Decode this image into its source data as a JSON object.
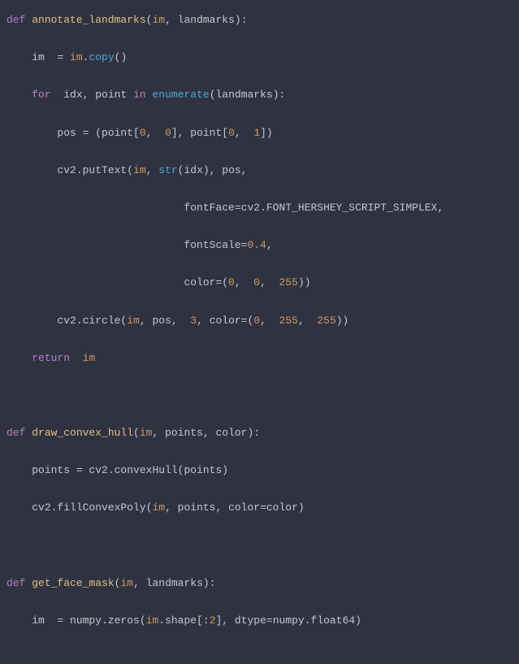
{
  "code": {
    "lines": [
      {
        "indent": 0,
        "tokens": [
          {
            "t": "def ",
            "c": "kw"
          },
          {
            "t": "annotate_landmarks",
            "c": "fn"
          },
          {
            "t": "(",
            "c": "punct"
          },
          {
            "t": "im",
            "c": "param"
          },
          {
            "t": ", landmarks):",
            "c": "punct"
          }
        ]
      },
      {
        "indent": 4,
        "tokens": [
          {
            "t": "im  = ",
            "c": "punct"
          },
          {
            "t": "im",
            "c": "param"
          },
          {
            "t": ".",
            "c": "punct"
          },
          {
            "t": "copy",
            "c": "call"
          },
          {
            "t": "()",
            "c": "punct"
          }
        ]
      },
      {
        "indent": 4,
        "tokens": [
          {
            "t": "for  ",
            "c": "kw"
          },
          {
            "t": "idx, point ",
            "c": "punct"
          },
          {
            "t": "in ",
            "c": "kw"
          },
          {
            "t": "enumerate",
            "c": "call"
          },
          {
            "t": "(landmarks):",
            "c": "punct"
          }
        ]
      },
      {
        "indent": 8,
        "tokens": [
          {
            "t": "pos = (point[",
            "c": "punct"
          },
          {
            "t": "0",
            "c": "num"
          },
          {
            "t": ",  ",
            "c": "punct"
          },
          {
            "t": "0",
            "c": "num"
          },
          {
            "t": "], point[",
            "c": "punct"
          },
          {
            "t": "0",
            "c": "num"
          },
          {
            "t": ",  ",
            "c": "punct"
          },
          {
            "t": "1",
            "c": "num"
          },
          {
            "t": "])",
            "c": "punct"
          }
        ]
      },
      {
        "indent": 8,
        "tokens": [
          {
            "t": "cv2.putText(",
            "c": "punct"
          },
          {
            "t": "im",
            "c": "param"
          },
          {
            "t": ", ",
            "c": "punct"
          },
          {
            "t": "str",
            "c": "call"
          },
          {
            "t": "(idx), pos,",
            "c": "punct"
          }
        ]
      },
      {
        "indent": 28,
        "tokens": [
          {
            "t": "fontFace=cv2.FONT_HERSHEY_SCRIPT_SIMPLEX,",
            "c": "punct"
          }
        ]
      },
      {
        "indent": 28,
        "tokens": [
          {
            "t": "fontScale=",
            "c": "punct"
          },
          {
            "t": "0.4",
            "c": "num"
          },
          {
            "t": ",",
            "c": "punct"
          }
        ]
      },
      {
        "indent": 28,
        "tokens": [
          {
            "t": "color=(",
            "c": "punct"
          },
          {
            "t": "0",
            "c": "num"
          },
          {
            "t": ",  ",
            "c": "punct"
          },
          {
            "t": "0",
            "c": "num"
          },
          {
            "t": ",  ",
            "c": "punct"
          },
          {
            "t": "255",
            "c": "num"
          },
          {
            "t": "))",
            "c": "punct"
          }
        ]
      },
      {
        "indent": 8,
        "tokens": [
          {
            "t": "cv2.circle(",
            "c": "punct"
          },
          {
            "t": "im",
            "c": "param"
          },
          {
            "t": ", pos,  ",
            "c": "punct"
          },
          {
            "t": "3",
            "c": "num"
          },
          {
            "t": ", color=(",
            "c": "punct"
          },
          {
            "t": "0",
            "c": "num"
          },
          {
            "t": ",  ",
            "c": "punct"
          },
          {
            "t": "255",
            "c": "num"
          },
          {
            "t": ",  ",
            "c": "punct"
          },
          {
            "t": "255",
            "c": "num"
          },
          {
            "t": "))",
            "c": "punct"
          }
        ]
      },
      {
        "indent": 4,
        "tokens": [
          {
            "t": "return  ",
            "c": "kw"
          },
          {
            "t": "im",
            "c": "param"
          }
        ]
      },
      {
        "indent": 0,
        "tokens": []
      },
      {
        "indent": 0,
        "tokens": [
          {
            "t": "def ",
            "c": "kw"
          },
          {
            "t": "draw_convex_hull",
            "c": "fn"
          },
          {
            "t": "(",
            "c": "punct"
          },
          {
            "t": "im",
            "c": "param"
          },
          {
            "t": ", points, color):",
            "c": "punct"
          }
        ]
      },
      {
        "indent": 4,
        "tokens": [
          {
            "t": "points = cv2.convexHull(points)",
            "c": "punct"
          }
        ]
      },
      {
        "indent": 4,
        "tokens": [
          {
            "t": "cv2.fillConvexPoly(",
            "c": "punct"
          },
          {
            "t": "im",
            "c": "param"
          },
          {
            "t": ", points, color=color)",
            "c": "punct"
          }
        ]
      },
      {
        "indent": 0,
        "tokens": []
      },
      {
        "indent": 0,
        "tokens": [
          {
            "t": "def ",
            "c": "kw"
          },
          {
            "t": "get_face_mask",
            "c": "fn"
          },
          {
            "t": "(",
            "c": "punct"
          },
          {
            "t": "im",
            "c": "param"
          },
          {
            "t": ", landmarks):",
            "c": "punct"
          }
        ]
      },
      {
        "indent": 4,
        "tokens": [
          {
            "t": "im  = numpy.zeros(",
            "c": "punct"
          },
          {
            "t": "im",
            "c": "param"
          },
          {
            "t": ".shape[:",
            "c": "punct"
          },
          {
            "t": "2",
            "c": "num"
          },
          {
            "t": "], dtype=numpy.float64)",
            "c": "punct"
          }
        ]
      }
    ]
  }
}
